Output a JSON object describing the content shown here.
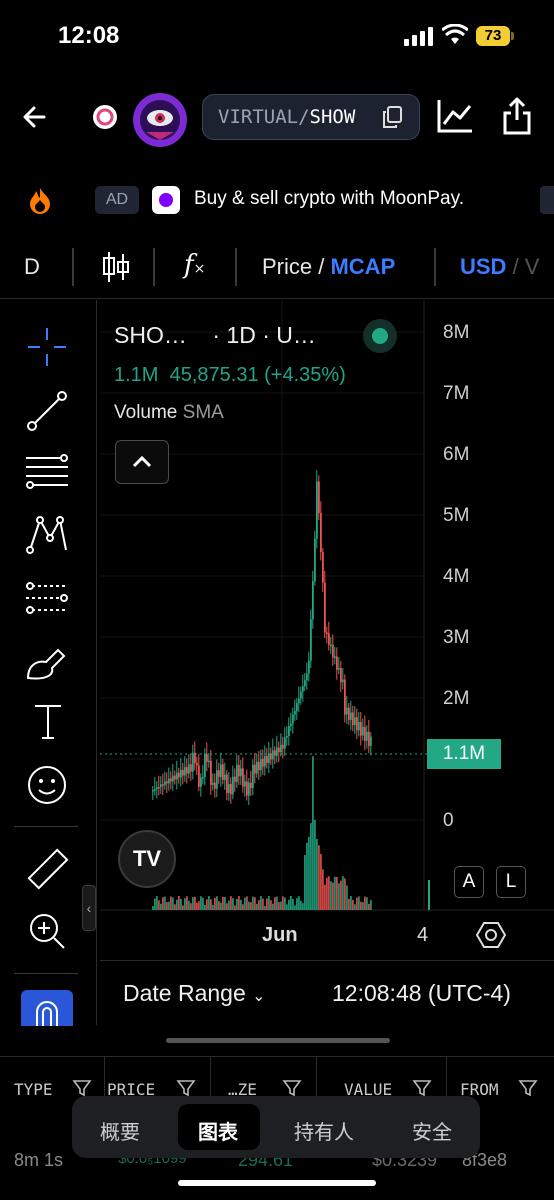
{
  "status": {
    "time": "12:08",
    "battery": "73"
  },
  "header": {
    "pair_left": "VIRTUAL",
    "pair_sep": "/",
    "pair_right": "SHOW",
    "token_logo_text": "THE VITA ROWS SHOW"
  },
  "ad": {
    "badge": "AD",
    "text": "Buy & sell crypto with MoonPay."
  },
  "toolbar": {
    "interval": "D",
    "price_label": "Price",
    "slash": " / ",
    "mcap_label": "MCAP",
    "currency": "USD",
    "currency_sep": " / V"
  },
  "legend": {
    "symbol": "SHO…",
    "meta": "· 1D · U…",
    "last": "1.1M",
    "change": "45,875.31 (+4.35%)",
    "volume_label": "Volume",
    "volume_sma": "SMA"
  },
  "price_axis": [
    "8M",
    "7M",
    "6M",
    "5M",
    "4M",
    "3M",
    "2M",
    "0"
  ],
  "last_price_tag": "1.1M",
  "x_axis": {
    "month": "Jun",
    "day": "4"
  },
  "buttons": {
    "auto": "A",
    "log": "L"
  },
  "footer": {
    "date_range": "Date Range",
    "clock": "12:08:48 (UTC-4)"
  },
  "table": {
    "headers": [
      "TYPE",
      "PRICE",
      "…ZE",
      "VALUE",
      "FROM"
    ],
    "row": [
      "8m 1s",
      "$0.0₅1099",
      "294.61",
      "$0.3239",
      "8f3e8"
    ]
  },
  "tabs": [
    "概要",
    "图表",
    "持有人",
    "安全"
  ],
  "colors": {
    "up": "#22a884",
    "down": "#ef5350",
    "accent": "#3d7bff"
  }
}
